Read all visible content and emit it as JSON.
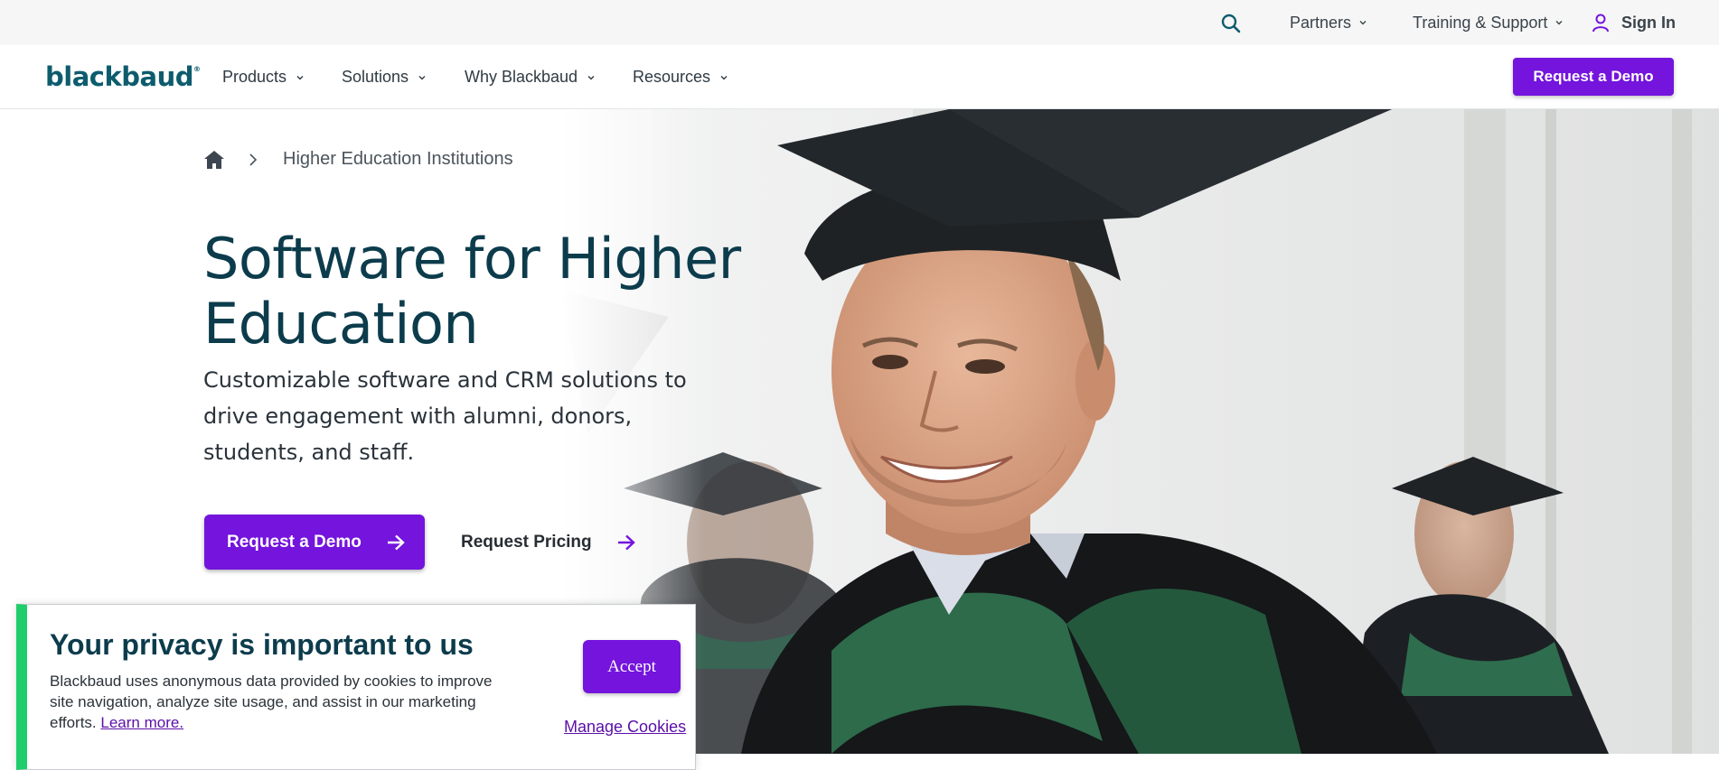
{
  "utility_bar": {
    "search_icon": "search-icon",
    "partners": "Partners",
    "training_support": "Training & Support",
    "sign_in": "Sign In"
  },
  "main_nav": {
    "logo": "blackbaud",
    "logo_mark": "®",
    "items": [
      {
        "label": "Products"
      },
      {
        "label": "Solutions"
      },
      {
        "label": "Why Blackbaud"
      },
      {
        "label": "Resources"
      }
    ],
    "demo_button": "Request a Demo"
  },
  "hero": {
    "breadcrumb": {
      "home_icon": "home-icon",
      "current": "Higher Education Institutions"
    },
    "title": "Software for Higher Education",
    "subtitle": "Customizable software and CRM solutions to drive engagement with alumni, donors, students, and staff.",
    "primary_cta": "Request a Demo",
    "secondary_cta": "Request Pricing"
  },
  "cookie_banner": {
    "title": "Your privacy is important to us",
    "text": "Blackbaud uses anonymous data provided by cookies to improve site navigation, analyze site usage, and assist in our marketing efforts.",
    "learn_more": "Learn more.",
    "accept": "Accept",
    "manage": "Manage Cookies"
  },
  "colors": {
    "brand_purple": "#7414dc",
    "heading_teal": "#0c3c4c",
    "logo_teal": "#0d5c6e",
    "accent_green": "#1fce6a"
  }
}
